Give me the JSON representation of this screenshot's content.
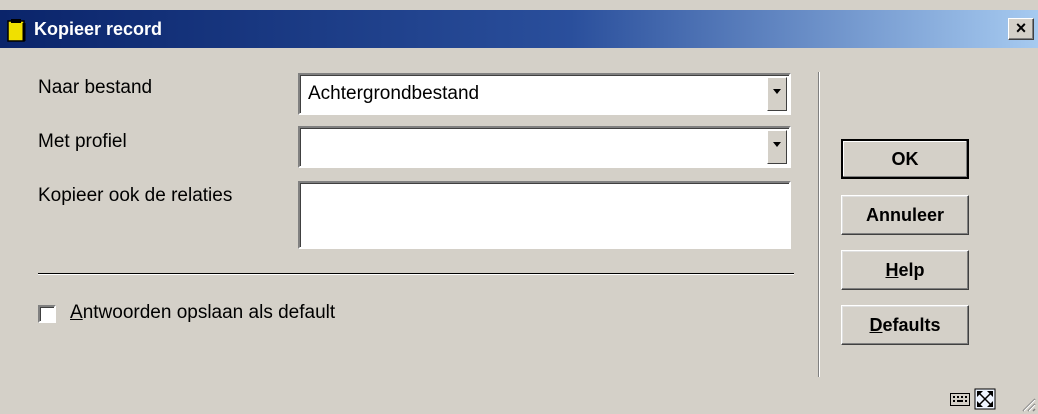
{
  "window": {
    "title": "Kopieer record",
    "close_label": "×"
  },
  "form": {
    "naar_bestand_label": "Naar bestand",
    "naar_bestand_value": "Achtergrondbestand",
    "met_profiel_label": "Met profiel",
    "met_profiel_value": "",
    "kopieer_relaties_label": "Kopieer ook de relaties",
    "kopieer_relaties_value": ""
  },
  "checkbox": {
    "label_accel": "A",
    "label_rest": "ntwoorden opslaan als default",
    "checked": false
  },
  "buttons": {
    "ok": "OK",
    "annuleer": "Annuleer",
    "help_accel": "H",
    "help_rest": "elp",
    "defaults_accel": "D",
    "defaults_rest": "efaults"
  },
  "icons": {
    "title": "document-icon",
    "status1": "keyboard-icon",
    "status2": "maximize-icon",
    "grip": "resize-grip-icon"
  }
}
